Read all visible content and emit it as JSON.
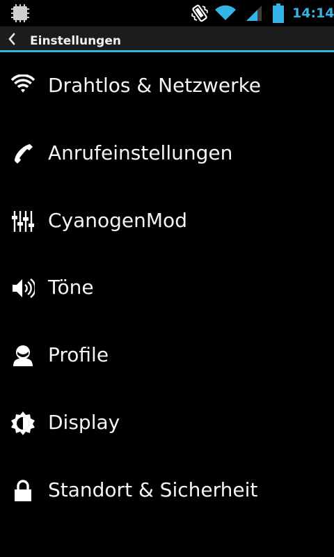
{
  "status_bar": {
    "time": "14:14",
    "accent_color": "#33b5e5",
    "icons": [
      "notification-icon",
      "vibrate-icon",
      "wifi-icon",
      "signal-icon",
      "battery-icon"
    ]
  },
  "action_bar": {
    "title": "Einstellungen",
    "back_icon": "chevron-left-icon",
    "divider_color": "#33b5e5"
  },
  "settings": {
    "items": [
      {
        "label": "Drahtlos & Netzwerke",
        "icon": "wifi-icon"
      },
      {
        "label": "Anrufeinstellungen",
        "icon": "phone-icon"
      },
      {
        "label": "CyanogenMod",
        "icon": "sliders-icon"
      },
      {
        "label": "Töne",
        "icon": "speaker-icon"
      },
      {
        "label": "Profile",
        "icon": "profile-icon"
      },
      {
        "label": "Display",
        "icon": "brightness-icon"
      },
      {
        "label": "Standort & Sicherheit",
        "icon": "lock-icon"
      }
    ]
  }
}
